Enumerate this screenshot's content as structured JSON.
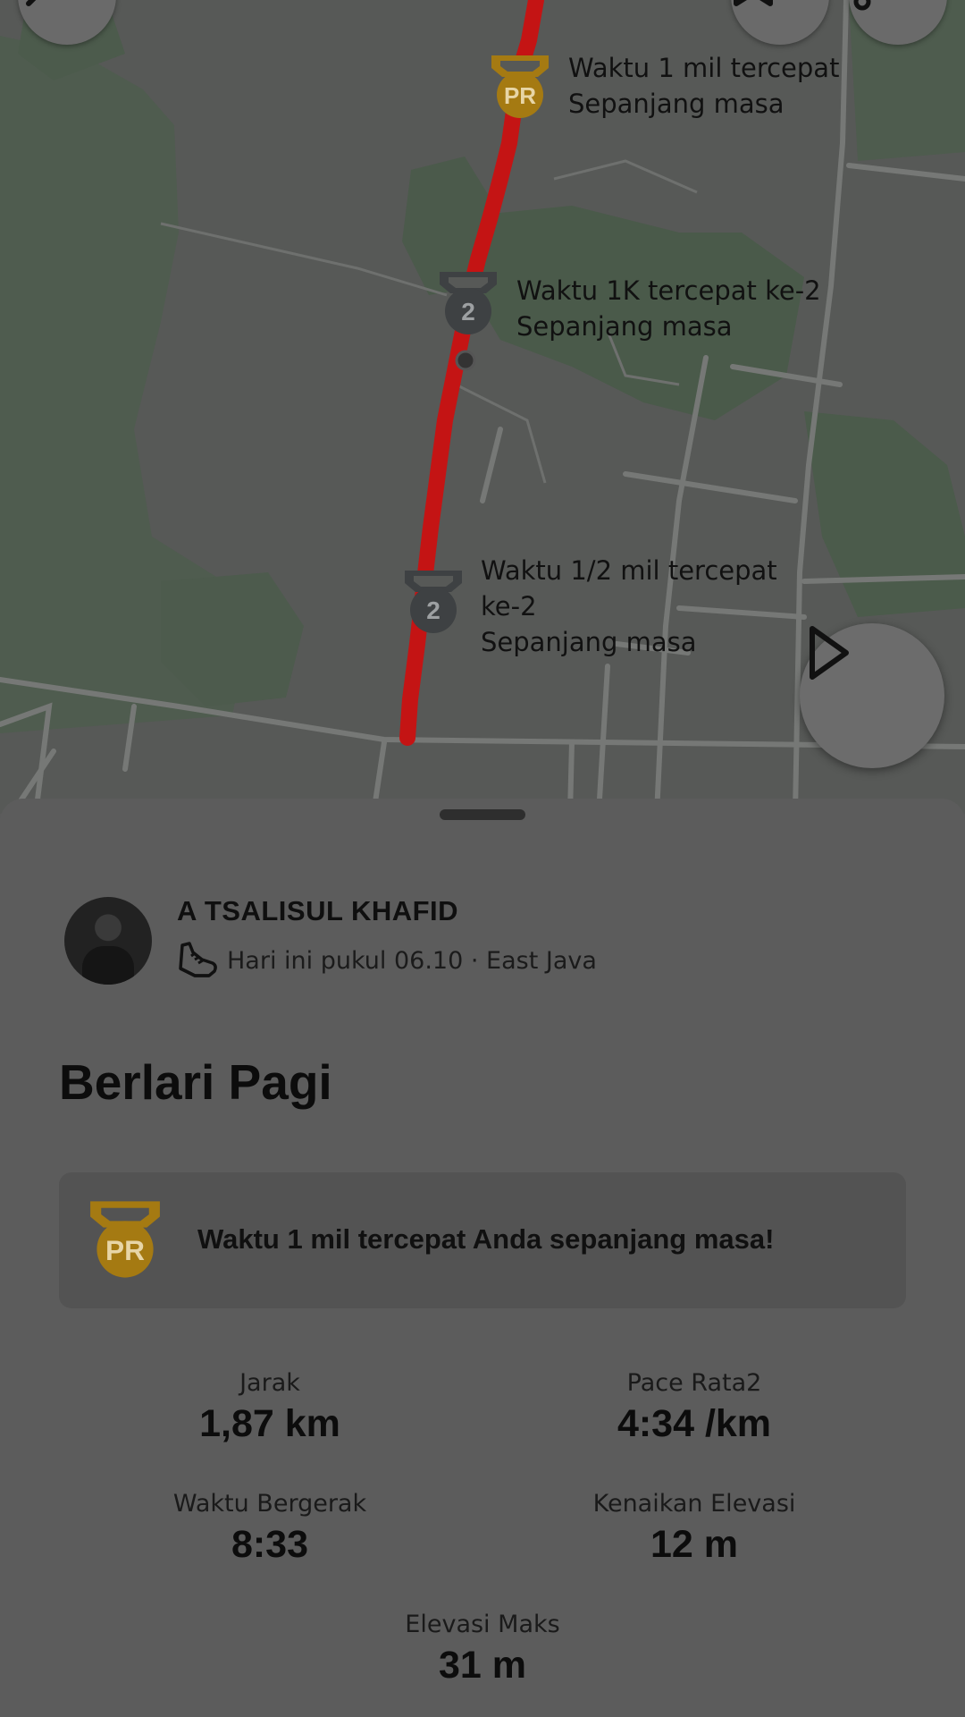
{
  "map": {
    "markers": [
      {
        "badge": "PR",
        "line1": "Waktu 1 mil tercepat",
        "line2": "Sepanjang masa"
      },
      {
        "badge": "2",
        "line1": "Waktu 1K tercepat ke-2",
        "line2": "Sepanjang masa"
      },
      {
        "badge": "2",
        "line1": "Waktu 1/2 mil tercepat",
        "line1b": "ke-2",
        "line2": "Sepanjang masa"
      }
    ],
    "colors": {
      "route": "#c41414",
      "pr_badge": "#a57a12",
      "rank_badge": "#3e4143"
    }
  },
  "athlete": {
    "name": "A TSALISUL KHAFID",
    "meta": "Hari ini pukul 06.10 · East Java"
  },
  "activity": {
    "title": "Berlari Pagi",
    "achievement": {
      "badge": "PR",
      "text": "Waktu 1 mil tercepat Anda sepanjang masa!"
    }
  },
  "stats": [
    {
      "label": "Jarak",
      "value": "1,87 km"
    },
    {
      "label": "Pace Rata2",
      "value": "4:34 /km"
    },
    {
      "label": "Waktu Bergerak",
      "value": "8:33"
    },
    {
      "label": "Kenaikan Elevasi",
      "value": "12 m"
    },
    {
      "label": "Elevasi Maks",
      "value": "31 m"
    }
  ]
}
